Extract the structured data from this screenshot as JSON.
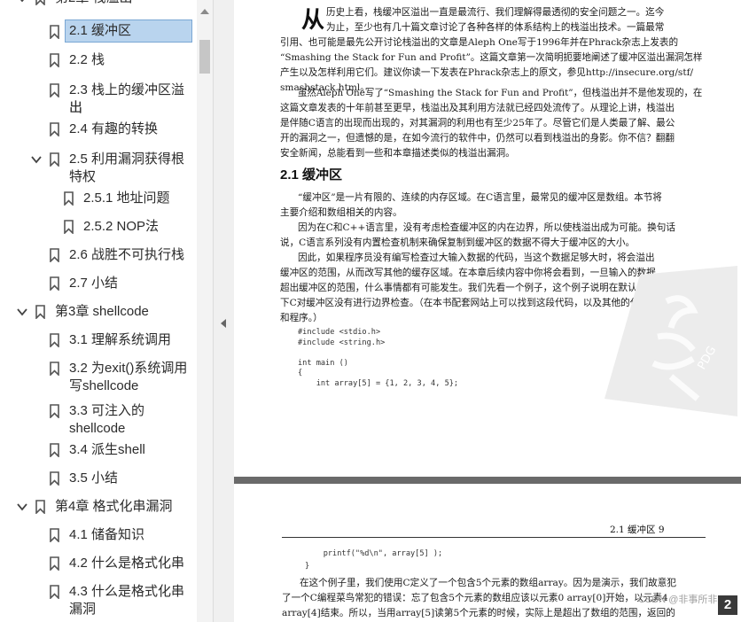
{
  "sidebar": {
    "top_partial_label": "第2章 栈溢出",
    "items": [
      {
        "label": "2.1 缓冲区",
        "selected": true
      },
      {
        "label": "2.2 栈"
      },
      {
        "label": "2.3 栈上的缓冲区溢出",
        "line2": "出"
      },
      {
        "label": "2.4 有趣的转换"
      },
      {
        "label": "2.5 利用漏洞获得根",
        "line2": "特权",
        "expanded": true
      },
      {
        "label": "2.5.1 地址问题"
      },
      {
        "label": "2.5.2 NOP法"
      },
      {
        "label": "2.6 战胜不可执行栈"
      },
      {
        "label": "2.7 小结"
      },
      {
        "label": "第3章 shellcode",
        "expanded": true
      },
      {
        "label": "3.1 理解系统调用"
      },
      {
        "label": "3.2 为exit()系统调用",
        "line2": "写shellcode"
      },
      {
        "label": "3.3 可注入的",
        "line2": "shellcode"
      },
      {
        "label": "3.4 派生shell"
      },
      {
        "label": "3.5 小结"
      },
      {
        "label": "第4章 格式化串漏洞",
        "expanded": true
      },
      {
        "label": "4.1 储备知识"
      },
      {
        "label": "4.2 什么是格式化串"
      },
      {
        "label": "4.3 什么是格式化串",
        "line2": "漏洞"
      }
    ]
  },
  "page1": {
    "dropcap": "从",
    "intro_lines": [
      "历史上看，栈缓冲区溢出一直是最流行、我们理解得最透彻的安全问题之一。迄今",
      "为止，至少也有几十篇文章讨论了各种各样的体系结构上的栈溢出技术。一篇最常",
      "引用、也可能是最先公开讨论栈溢出的文章是Aleph One写于1996年并在Phrack杂志上发表的",
      "“Smashing the Stack for Fun and Profit”。这篇文章第一次简明扼要地阐述了缓冲区溢出漏洞怎样",
      "产生以及怎样利用它们。建议你读一下发表在Phrack杂志上的原文，参见http://insecure.org/stf/",
      "smashstack.html。"
    ],
    "para2_lines": [
      "虽然Aleph One写了“Smashing the Stack for Fun and Profit”，但栈溢出并不是他发现的，在",
      "这篇文章发表的十年前甚至更早，栈溢出及其利用方法就已经四处流传了。从理论上讲，栈溢出",
      "是伴随C语言的出现而出现的，对其漏洞的利用也有至少25年了。尽管它们是人类最了解、最公",
      "开的漏洞之一，但遗憾的是，在如今流行的软件中，仍然可以看到栈溢出的身影。你不信？翻翻",
      "安全新闻，总能看到一些和本章描述类似的栈溢出漏洞。"
    ],
    "section_heading": "2.1   缓冲区",
    "body_lines": [
      "“缓冲区”是一片有限的、连续的内存区域。在C语言里，最常见的缓冲区是数组。本节将",
      "主要介绍和数组相关的内容。",
      "因为在C和C++语言里，没有考虑检查缓冲区的内在边界，所以使栈溢出成为可能。换句话",
      "说，C语言系列没有内置检查机制来确保复制到缓冲区的数据不得大于缓冲区的大小。",
      "因此，如果程序员没有编写检查过大输入数据的代码，当这个数据足够大时，将会溢出",
      "缓冲区的范围，从而改写其他的缓存区域。在本章后续内容中你将会看到，一旦输入的数据",
      "超出缓冲区的范围，什么事情都有可能发生。我们先看一个例子，这个例子说明在默认情况",
      "下C对缓冲区没有进行边界检查。（在本书配套网站上可以找到这段代码，以及其他的代码段",
      "和程序。）"
    ],
    "code_lines": [
      "#include <stdio.h>",
      "#include <string.h>",
      "",
      "int main ()",
      "{",
      "    int array[5] = {1, 2, 3, 4, 5};"
    ],
    "watermark_text": "PDG"
  },
  "page2": {
    "running_head": "2.1   缓冲区          9",
    "code_lines": [
      "    printf(\"%d\\n\", array[5] );",
      "}"
    ],
    "body_lines": [
      "在这个例子里，我们使用C定义了一个包含5个元素的数组array。因为是演示，我们故意犯",
      "了一个C编程菜鸟常犯的错误：忘了包含5个元素的数组应该以元素0 array[0]开始，以元素4",
      "array[4]结束。所以，当用array[5]读第5个元素的时候，实际上是超出了数组的范围，返回的"
    ],
    "credit": "CSDN @非事所非",
    "page_badge": "2"
  }
}
